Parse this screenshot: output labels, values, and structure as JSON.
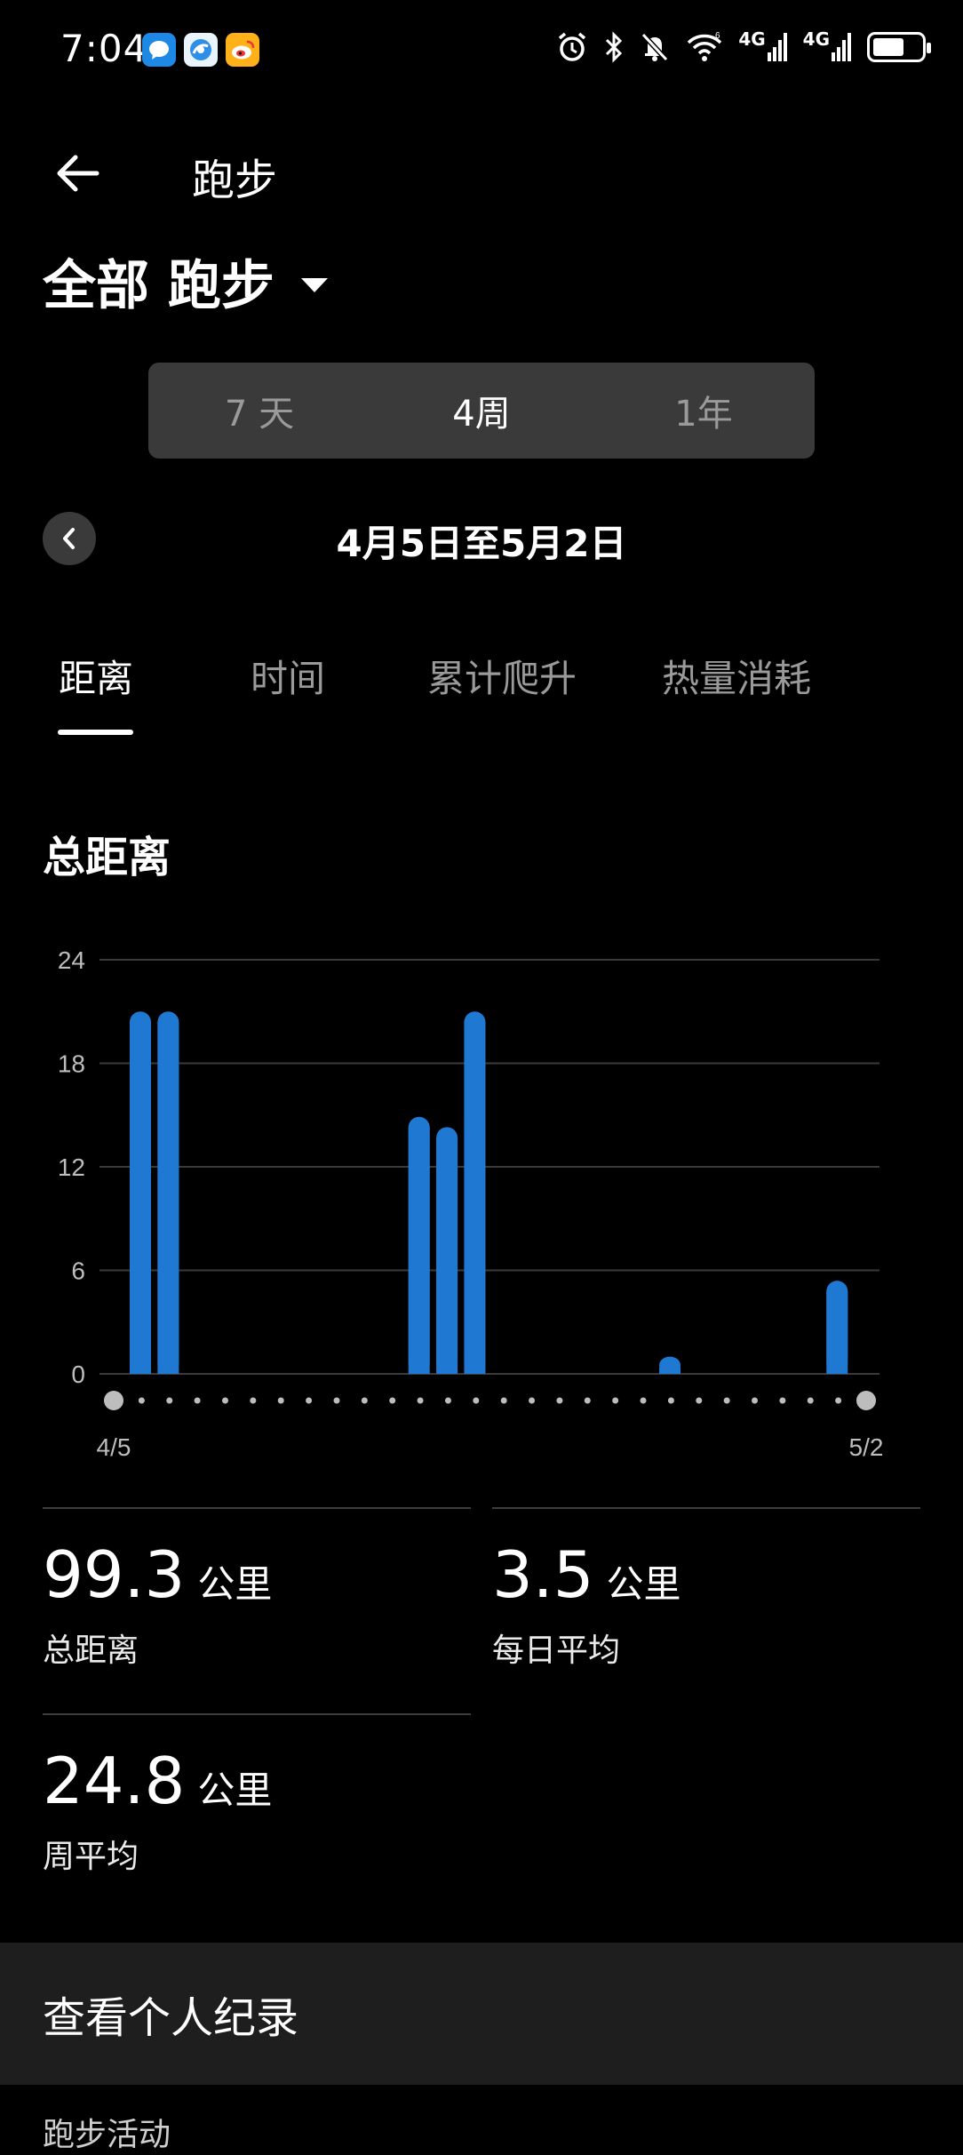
{
  "status_bar": {
    "time": "7:04",
    "apps": [
      "message-app-icon",
      "browser-app-icon",
      "weibo-app-icon"
    ],
    "network_1": "4G",
    "network_2": "4G"
  },
  "header": {
    "back_icon": "arrow-left-icon",
    "title": "跑步"
  },
  "filter": {
    "label": "全部 跑步"
  },
  "range_tabs": [
    {
      "label": "7 天",
      "active": false
    },
    {
      "label": "4周",
      "active": true
    },
    {
      "label": "1年",
      "active": false
    }
  ],
  "date_nav": {
    "range": "4月5日至5月2日"
  },
  "metric_tabs": [
    {
      "label": "距离",
      "active": true
    },
    {
      "label": "时间",
      "active": false
    },
    {
      "label": "累计爬升",
      "active": false
    },
    {
      "label": "热量消耗",
      "active": false
    }
  ],
  "section_title": "总距离",
  "chart_data": {
    "type": "bar",
    "x_start_label": "4/5",
    "x_end_label": "5/2",
    "categories_count": 28,
    "values": [
      21,
      21,
      0,
      0,
      0,
      0,
      0,
      0,
      0,
      0,
      14.9,
      14.3,
      21,
      0,
      0,
      0,
      0,
      0,
      0,
      1,
      0,
      0,
      0,
      0,
      0,
      5.4,
      0,
      0
    ],
    "y_ticks": [
      0,
      6,
      12,
      18,
      24
    ],
    "ylim": [
      0,
      24
    ],
    "grid": true,
    "bar_color": "#1f78d1"
  },
  "stats": [
    {
      "value": "99.3",
      "unit": "公里",
      "label": "总距离"
    },
    {
      "value": "3.5",
      "unit": "公里",
      "label": "每日平均"
    },
    {
      "value": "24.8",
      "unit": "公里",
      "label": "周平均"
    }
  ],
  "records": {
    "label": "查看个人纪录"
  },
  "activities": {
    "label": "跑步活动"
  }
}
